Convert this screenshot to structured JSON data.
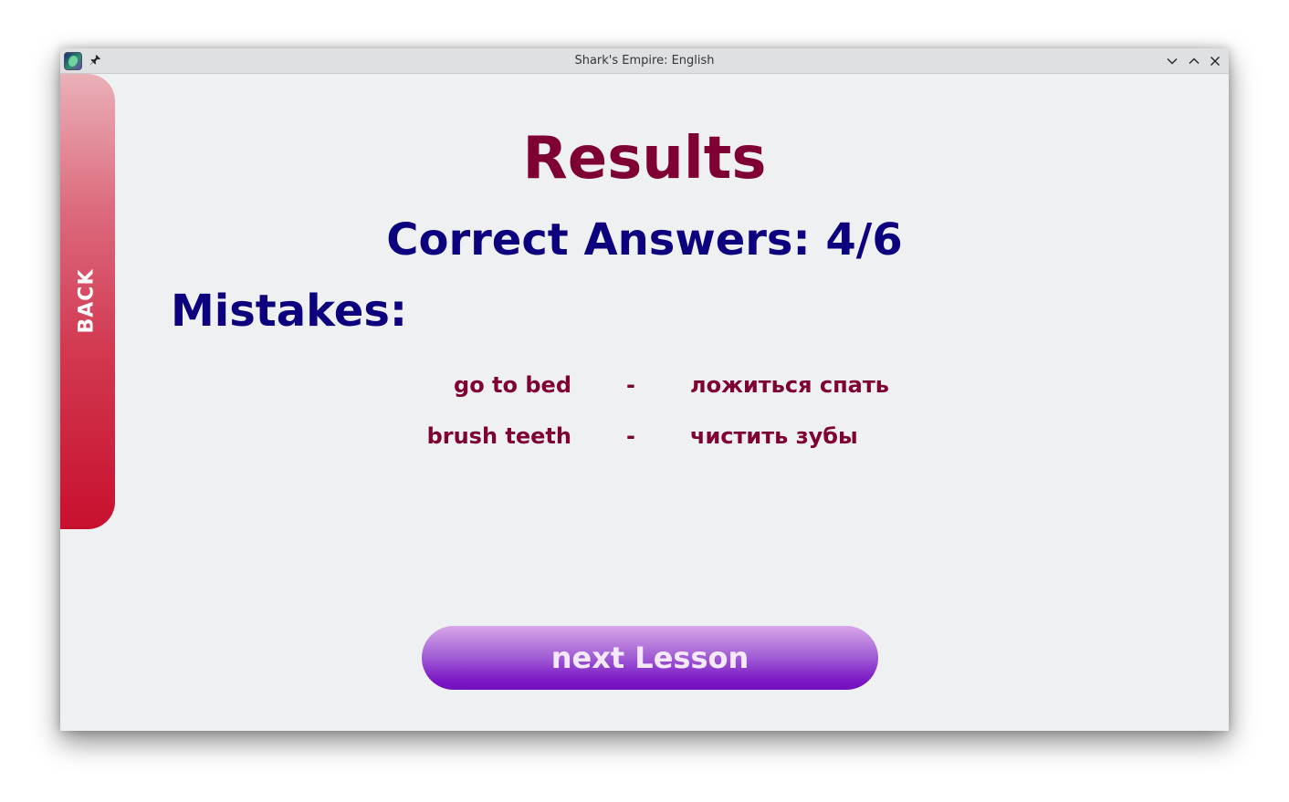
{
  "window": {
    "title": "Shark's Empire: English"
  },
  "titlebar_icons": {
    "app_icon": "app-logo-icon",
    "pin": "pin-icon",
    "minimize": "chevron-down-icon",
    "maximize": "chevron-up-icon",
    "close": "close-icon"
  },
  "sidebar": {
    "back_label": "BACK"
  },
  "results": {
    "title": "Results",
    "correct_answers": "Correct Answers: 4/6",
    "mistakes_heading": "Mistakes:"
  },
  "mistakes": [
    {
      "english": "go to bed",
      "separator": "-",
      "russian": "ложиться спать"
    },
    {
      "english": "brush teeth",
      "separator": "-",
      "russian": "чистить зубы"
    }
  ],
  "actions": {
    "next_label": "next Lesson"
  },
  "colors": {
    "title_color": "#7f0033",
    "heading_color": "#0d007e",
    "back_tab_color": "#c8102e",
    "next_button_color": "#7c18c6",
    "background": "#eff0f1"
  }
}
